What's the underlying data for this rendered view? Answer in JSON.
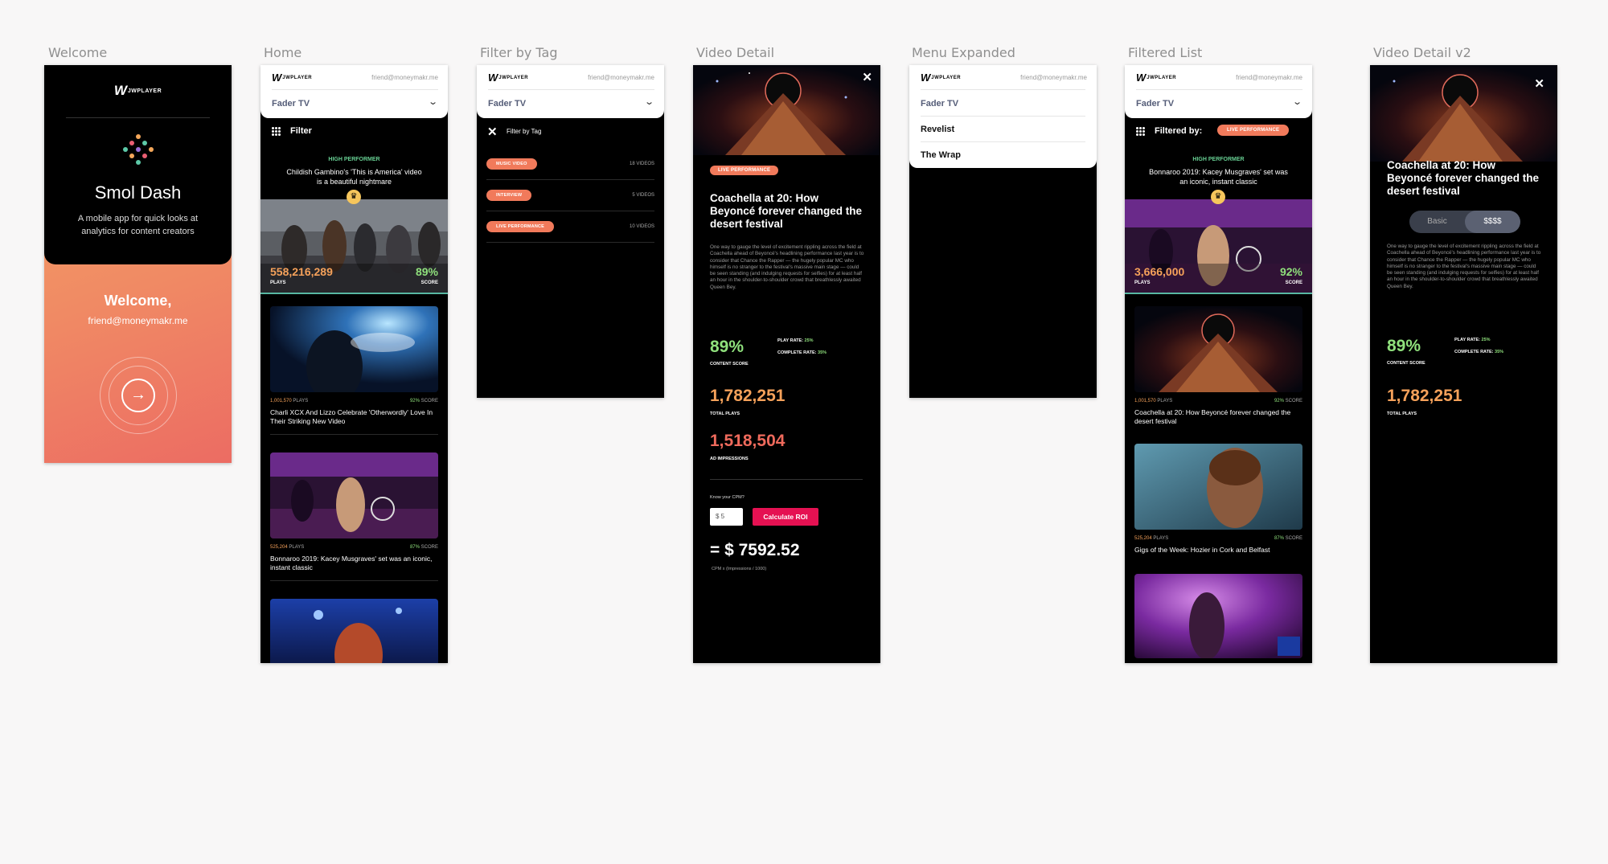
{
  "frames": {
    "welcome": "Welcome",
    "home": "Home",
    "filter_by_tag": "Filter by Tag",
    "video_detail": "Video Detail",
    "menu_expanded": "Menu Expanded",
    "filtered_list": "Filtered List",
    "video_detail_v2": "Video Detail v2"
  },
  "brand": {
    "mark": "W",
    "word": "JWPLAYER"
  },
  "user_email": "friend@moneymakr.me",
  "welcome": {
    "app_title": "Smol Dash",
    "tagline": "A mobile app for quick looks at analytics for content creators",
    "greeting": "Welcome,",
    "email": "friend@moneymakr.me",
    "go_icon": "→"
  },
  "header": {
    "selected_property": "Fader TV",
    "chevron_icon": "⌄"
  },
  "home": {
    "filter_label": "Filter",
    "featured": {
      "eyebrow": "HIGH PERFORMER",
      "title": "Childish Gambino's 'This is America' video is a beautiful nightmare",
      "plays": "558,216,289",
      "plays_label": "PLAYS",
      "score": "89%",
      "score_label": "SCORE"
    },
    "items": [
      {
        "plays": "1,001,570",
        "score": "92%",
        "title": "Charli XCX And Lizzo Celebrate 'Otherwordly' Love In Their Striking New Video"
      },
      {
        "plays": "525,204",
        "score": "87%",
        "title": "Bonnaroo 2019: Kacey Musgraves' set was an iconic, instant classic"
      }
    ],
    "plays_suffix": "PLAYS",
    "score_suffix": "SCORE"
  },
  "filter_by_tag": {
    "title": "Filter by Tag",
    "close_icon": "✕",
    "tags": [
      {
        "name": "MUSIC VIDEO",
        "count": "18 VIDEOS"
      },
      {
        "name": "INTERVIEW",
        "count": "5 VIDEOS"
      },
      {
        "name": "LIVE PERFORMANCE",
        "count": "10 VIDEOS"
      }
    ]
  },
  "video_detail": {
    "close_icon": "✕",
    "tag": "LIVE PERFORMANCE",
    "title": "Coachella at 20: How Beyoncé forever changed the desert festival",
    "description": "One way to gauge the level of excitement rippling across the field at Coachella ahead of Beyoncé's headlining performance last year is to consider that Chance the Rapper — the hugely popular MC who himself is no stranger to the festival's massive main stage — could be seen standing (and indulging requests for selfies) for at least half an hour in the shoulder-to-shoulder crowd that breathlessly awaited Queen Bey.",
    "content_score": "89%",
    "content_score_label": "CONTENT SCORE",
    "play_rate_label": "PLAY RATE:",
    "play_rate": "25%",
    "complete_rate_label": "COMPLETE RATE:",
    "complete_rate": "35%",
    "total_plays": "1,782,251",
    "total_plays_label": "TOTAL PLAYS",
    "ad_impressions": "1,518,504",
    "ad_impressions_label": "AD IMPRESSIONS",
    "cpm_prompt": "Know your CPM?",
    "cpm_value": "$   5",
    "calc_button": "Calculate ROI",
    "roi": "= $ 7592.52",
    "formula": "CPM x (Impressions / 1000)"
  },
  "menu": {
    "items": [
      "Fader TV",
      "Revelist",
      "The Wrap"
    ]
  },
  "filtered_list": {
    "filtered_by": "Filtered by:",
    "active_tag": "LIVE PERFORMANCE",
    "featured": {
      "eyebrow": "HIGH PERFORMER",
      "title": "Bonnaroo 2019: Kacey Musgraves' set was an iconic, instant classic",
      "plays": "3,666,000",
      "plays_label": "PLAYS",
      "score": "92%",
      "score_label": "SCORE"
    },
    "items": [
      {
        "plays": "1,001,570",
        "score": "92%",
        "title": "Coachella at 20: How Beyoncé forever changed the desert festival"
      },
      {
        "plays": "525,204",
        "score": "87%",
        "title": "Gigs of the Week: Hozier in Cork and Belfast"
      }
    ]
  },
  "video_detail_v2": {
    "tabs": [
      "Basic",
      "$$$$"
    ],
    "selected_tab": "$$$$"
  },
  "colors": {
    "accent_orange": "#f17a5b",
    "plays_orange": "#f5a15a",
    "score_green": "#8fe07c",
    "impressions_red": "#ef6a5c",
    "cta_pink": "#e51152",
    "eyebrow_green": "#67cf93"
  }
}
